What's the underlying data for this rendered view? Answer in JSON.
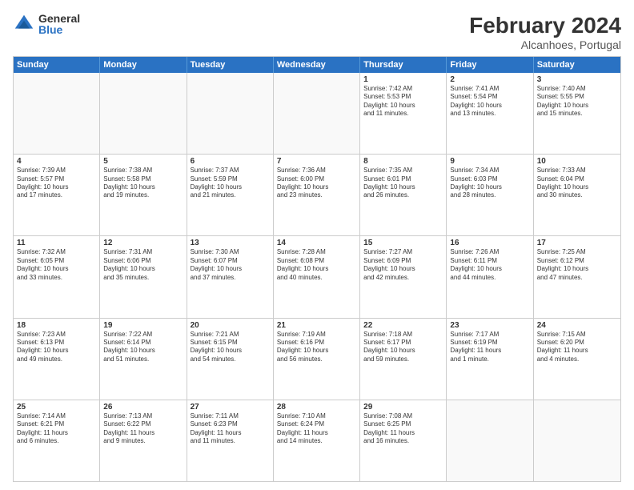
{
  "logo": {
    "general": "General",
    "blue": "Blue"
  },
  "header": {
    "title": "February 2024",
    "subtitle": "Alcanhoes, Portugal"
  },
  "calendar": {
    "days": [
      "Sunday",
      "Monday",
      "Tuesday",
      "Wednesday",
      "Thursday",
      "Friday",
      "Saturday"
    ],
    "rows": [
      [
        {
          "day": "",
          "content": ""
        },
        {
          "day": "",
          "content": ""
        },
        {
          "day": "",
          "content": ""
        },
        {
          "day": "",
          "content": ""
        },
        {
          "day": "1",
          "content": "Sunrise: 7:42 AM\nSunset: 5:53 PM\nDaylight: 10 hours\nand 11 minutes."
        },
        {
          "day": "2",
          "content": "Sunrise: 7:41 AM\nSunset: 5:54 PM\nDaylight: 10 hours\nand 13 minutes."
        },
        {
          "day": "3",
          "content": "Sunrise: 7:40 AM\nSunset: 5:55 PM\nDaylight: 10 hours\nand 15 minutes."
        }
      ],
      [
        {
          "day": "4",
          "content": "Sunrise: 7:39 AM\nSunset: 5:57 PM\nDaylight: 10 hours\nand 17 minutes."
        },
        {
          "day": "5",
          "content": "Sunrise: 7:38 AM\nSunset: 5:58 PM\nDaylight: 10 hours\nand 19 minutes."
        },
        {
          "day": "6",
          "content": "Sunrise: 7:37 AM\nSunset: 5:59 PM\nDaylight: 10 hours\nand 21 minutes."
        },
        {
          "day": "7",
          "content": "Sunrise: 7:36 AM\nSunset: 6:00 PM\nDaylight: 10 hours\nand 23 minutes."
        },
        {
          "day": "8",
          "content": "Sunrise: 7:35 AM\nSunset: 6:01 PM\nDaylight: 10 hours\nand 26 minutes."
        },
        {
          "day": "9",
          "content": "Sunrise: 7:34 AM\nSunset: 6:03 PM\nDaylight: 10 hours\nand 28 minutes."
        },
        {
          "day": "10",
          "content": "Sunrise: 7:33 AM\nSunset: 6:04 PM\nDaylight: 10 hours\nand 30 minutes."
        }
      ],
      [
        {
          "day": "11",
          "content": "Sunrise: 7:32 AM\nSunset: 6:05 PM\nDaylight: 10 hours\nand 33 minutes."
        },
        {
          "day": "12",
          "content": "Sunrise: 7:31 AM\nSunset: 6:06 PM\nDaylight: 10 hours\nand 35 minutes."
        },
        {
          "day": "13",
          "content": "Sunrise: 7:30 AM\nSunset: 6:07 PM\nDaylight: 10 hours\nand 37 minutes."
        },
        {
          "day": "14",
          "content": "Sunrise: 7:28 AM\nSunset: 6:08 PM\nDaylight: 10 hours\nand 40 minutes."
        },
        {
          "day": "15",
          "content": "Sunrise: 7:27 AM\nSunset: 6:09 PM\nDaylight: 10 hours\nand 42 minutes."
        },
        {
          "day": "16",
          "content": "Sunrise: 7:26 AM\nSunset: 6:11 PM\nDaylight: 10 hours\nand 44 minutes."
        },
        {
          "day": "17",
          "content": "Sunrise: 7:25 AM\nSunset: 6:12 PM\nDaylight: 10 hours\nand 47 minutes."
        }
      ],
      [
        {
          "day": "18",
          "content": "Sunrise: 7:23 AM\nSunset: 6:13 PM\nDaylight: 10 hours\nand 49 minutes."
        },
        {
          "day": "19",
          "content": "Sunrise: 7:22 AM\nSunset: 6:14 PM\nDaylight: 10 hours\nand 51 minutes."
        },
        {
          "day": "20",
          "content": "Sunrise: 7:21 AM\nSunset: 6:15 PM\nDaylight: 10 hours\nand 54 minutes."
        },
        {
          "day": "21",
          "content": "Sunrise: 7:19 AM\nSunset: 6:16 PM\nDaylight: 10 hours\nand 56 minutes."
        },
        {
          "day": "22",
          "content": "Sunrise: 7:18 AM\nSunset: 6:17 PM\nDaylight: 10 hours\nand 59 minutes."
        },
        {
          "day": "23",
          "content": "Sunrise: 7:17 AM\nSunset: 6:19 PM\nDaylight: 11 hours\nand 1 minute."
        },
        {
          "day": "24",
          "content": "Sunrise: 7:15 AM\nSunset: 6:20 PM\nDaylight: 11 hours\nand 4 minutes."
        }
      ],
      [
        {
          "day": "25",
          "content": "Sunrise: 7:14 AM\nSunset: 6:21 PM\nDaylight: 11 hours\nand 6 minutes."
        },
        {
          "day": "26",
          "content": "Sunrise: 7:13 AM\nSunset: 6:22 PM\nDaylight: 11 hours\nand 9 minutes."
        },
        {
          "day": "27",
          "content": "Sunrise: 7:11 AM\nSunset: 6:23 PM\nDaylight: 11 hours\nand 11 minutes."
        },
        {
          "day": "28",
          "content": "Sunrise: 7:10 AM\nSunset: 6:24 PM\nDaylight: 11 hours\nand 14 minutes."
        },
        {
          "day": "29",
          "content": "Sunrise: 7:08 AM\nSunset: 6:25 PM\nDaylight: 11 hours\nand 16 minutes."
        },
        {
          "day": "",
          "content": ""
        },
        {
          "day": "",
          "content": ""
        }
      ]
    ]
  }
}
